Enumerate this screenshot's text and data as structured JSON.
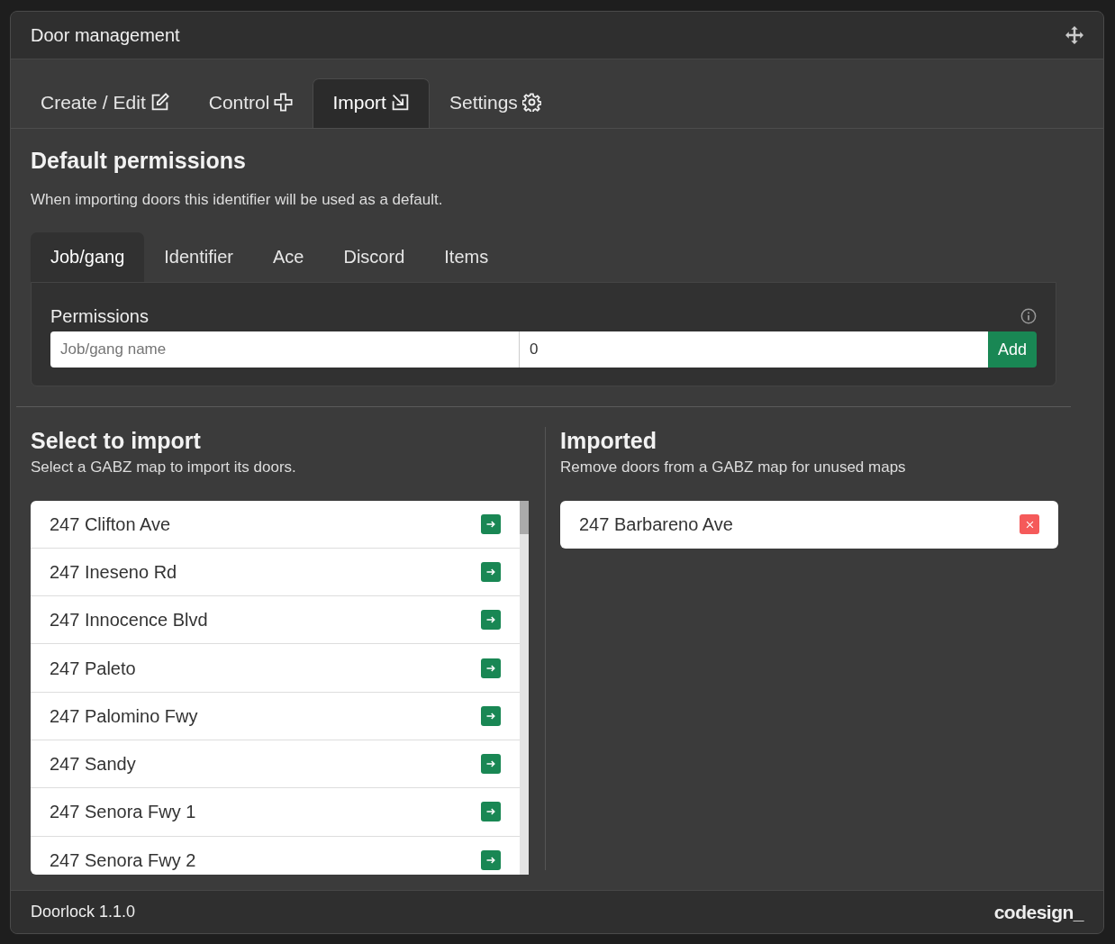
{
  "window": {
    "title": "Door management"
  },
  "tabs": [
    {
      "label": "Create / Edit",
      "selected": false
    },
    {
      "label": "Control",
      "selected": false
    },
    {
      "label": "Import",
      "selected": true
    },
    {
      "label": "Settings",
      "selected": false
    }
  ],
  "default_permissions": {
    "title": "Default permissions",
    "description": "When importing doors this identifier will be used as a default.",
    "tabs": [
      {
        "label": "Job/gang",
        "selected": true
      },
      {
        "label": "Identifier",
        "selected": false
      },
      {
        "label": "Ace",
        "selected": false
      },
      {
        "label": "Discord",
        "selected": false
      },
      {
        "label": "Items",
        "selected": false
      }
    ],
    "label": "Permissions",
    "name_field": {
      "placeholder": "Job/gang name"
    },
    "grade_field": {
      "value": "0"
    },
    "add_button": "Add"
  },
  "select_to_import": {
    "title": "Select to import",
    "description": "Select a GABZ map to import its doors.",
    "items": [
      "247 Clifton Ave",
      "247 Ineseno Rd",
      "247 Innocence Blvd",
      "247 Paleto",
      "247 Palomino Fwy",
      "247 Sandy",
      "247 Senora Fwy 1",
      "247 Senora Fwy 2"
    ]
  },
  "imported": {
    "title": "Imported",
    "description": "Remove doors from a GABZ map for unused maps",
    "items": [
      "247 Barbareno Ave"
    ]
  },
  "status_bar": {
    "version": "Doorlock 1.1.0",
    "brand": "codesign_"
  }
}
